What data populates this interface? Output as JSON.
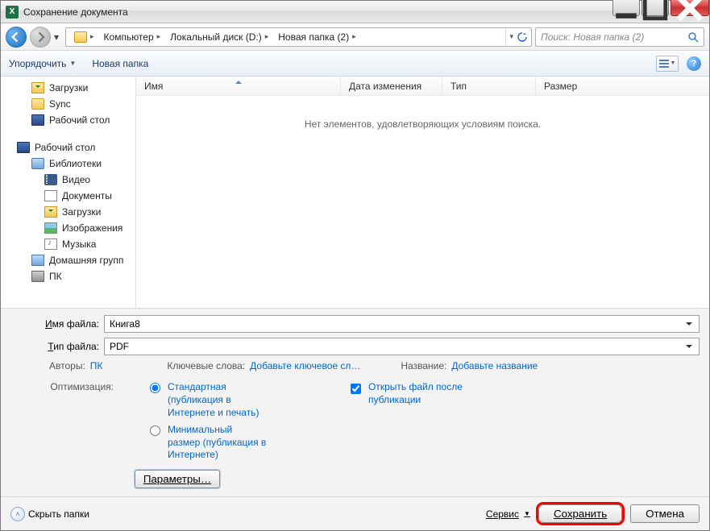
{
  "titlebar": {
    "title": "Сохранение документа",
    "blur_behind": ""
  },
  "nav": {
    "crumbs": [
      "Компьютер",
      "Локальный диск (D:)",
      "Новая папка (2)"
    ],
    "search_placeholder": "Поиск: Новая папка (2)"
  },
  "toolbar": {
    "organize": "Упорядочить",
    "new_folder": "Новая папка"
  },
  "tree": {
    "quick": [
      "Загрузки",
      "Sync",
      "Рабочий стол"
    ],
    "desktop": "Рабочий стол",
    "libraries": "Библиотеки",
    "lib_items": [
      "Видео",
      "Документы",
      "Загрузки",
      "Изображения",
      "Музыка"
    ],
    "homegroup": "Домашняя групп",
    "pc": "ПК"
  },
  "columns": {
    "name": "Имя",
    "date": "Дата изменения",
    "type": "Тип",
    "size": "Размер"
  },
  "empty": "Нет элементов, удовлетворяющих условиям поиска.",
  "form": {
    "filename_label_pre": "",
    "filename_underline": "И",
    "filename_label_post": "мя файла:",
    "filetype_label_pre": "",
    "filetype_underline": "Т",
    "filetype_label_post": "ип файла:",
    "filename_value": "Книга8",
    "filetype_value": "PDF",
    "authors_label": "Авторы:",
    "authors_value": "ПК",
    "keywords_label": "Ключевые слова:",
    "keywords_value": "Добавьте ключевое сл…",
    "title_label": "Название:",
    "title_value": "Добавьте название",
    "opt_label": "Оптимизация:",
    "opt_standard": "Стандартная (публикация в Интернете и печать)",
    "opt_min": "Минимальный размер (публикация в Интернете)",
    "open_after": "Открыть файл после публикации",
    "params": "Параметры…"
  },
  "footer": {
    "hide_folders": "Скрыть папки",
    "service": "Сервис",
    "save": "Сохранить",
    "cancel": "Отмена"
  }
}
